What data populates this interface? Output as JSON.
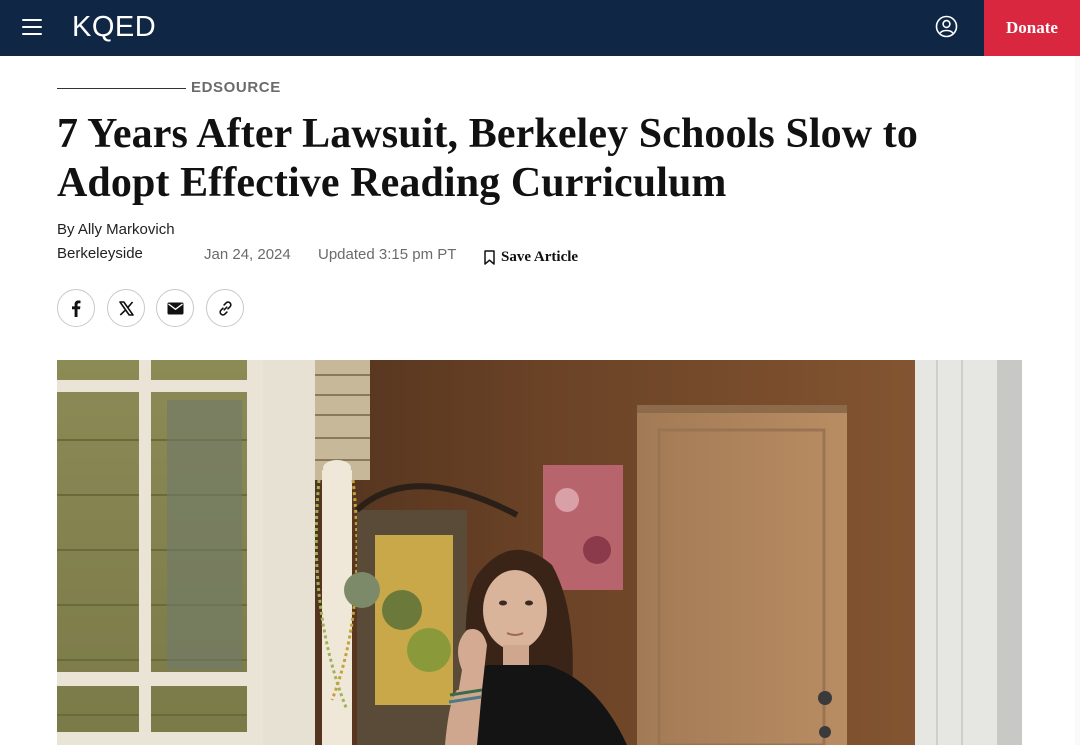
{
  "header": {
    "logo": "KQED",
    "donate_label": "Donate"
  },
  "article": {
    "kicker": "EDSOURCE",
    "title": "7 Years After Lawsuit, Berkeley Schools Slow to Adopt Effective Reading Curriculum",
    "byline": "By Ally Markovich",
    "source": "Berkeleyside",
    "date": "Jan 24, 2024",
    "updated": "Updated 3:15 pm PT",
    "save_label": "Save Article"
  },
  "share": {
    "icons": [
      "facebook-icon",
      "x-icon",
      "email-icon",
      "link-icon"
    ]
  },
  "colors": {
    "header_bg": "#0f2744",
    "donate_bg": "#d8273f"
  }
}
